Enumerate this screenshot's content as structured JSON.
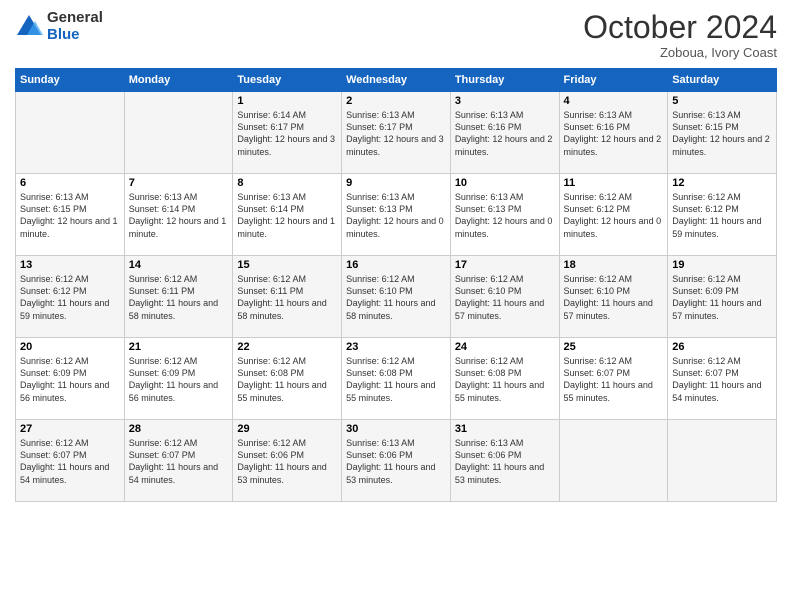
{
  "logo": {
    "general": "General",
    "blue": "Blue"
  },
  "header": {
    "month": "October 2024",
    "location": "Zoboua, Ivory Coast"
  },
  "weekdays": [
    "Sunday",
    "Monday",
    "Tuesday",
    "Wednesday",
    "Thursday",
    "Friday",
    "Saturday"
  ],
  "weeks": [
    [
      {
        "day": "",
        "text": ""
      },
      {
        "day": "",
        "text": ""
      },
      {
        "day": "1",
        "text": "Sunrise: 6:14 AM\nSunset: 6:17 PM\nDaylight: 12 hours and 3 minutes."
      },
      {
        "day": "2",
        "text": "Sunrise: 6:13 AM\nSunset: 6:17 PM\nDaylight: 12 hours and 3 minutes."
      },
      {
        "day": "3",
        "text": "Sunrise: 6:13 AM\nSunset: 6:16 PM\nDaylight: 12 hours and 2 minutes."
      },
      {
        "day": "4",
        "text": "Sunrise: 6:13 AM\nSunset: 6:16 PM\nDaylight: 12 hours and 2 minutes."
      },
      {
        "day": "5",
        "text": "Sunrise: 6:13 AM\nSunset: 6:15 PM\nDaylight: 12 hours and 2 minutes."
      }
    ],
    [
      {
        "day": "6",
        "text": "Sunrise: 6:13 AM\nSunset: 6:15 PM\nDaylight: 12 hours and 1 minute."
      },
      {
        "day": "7",
        "text": "Sunrise: 6:13 AM\nSunset: 6:14 PM\nDaylight: 12 hours and 1 minute."
      },
      {
        "day": "8",
        "text": "Sunrise: 6:13 AM\nSunset: 6:14 PM\nDaylight: 12 hours and 1 minute."
      },
      {
        "day": "9",
        "text": "Sunrise: 6:13 AM\nSunset: 6:13 PM\nDaylight: 12 hours and 0 minutes."
      },
      {
        "day": "10",
        "text": "Sunrise: 6:13 AM\nSunset: 6:13 PM\nDaylight: 12 hours and 0 minutes."
      },
      {
        "day": "11",
        "text": "Sunrise: 6:12 AM\nSunset: 6:12 PM\nDaylight: 12 hours and 0 minutes."
      },
      {
        "day": "12",
        "text": "Sunrise: 6:12 AM\nSunset: 6:12 PM\nDaylight: 11 hours and 59 minutes."
      }
    ],
    [
      {
        "day": "13",
        "text": "Sunrise: 6:12 AM\nSunset: 6:12 PM\nDaylight: 11 hours and 59 minutes."
      },
      {
        "day": "14",
        "text": "Sunrise: 6:12 AM\nSunset: 6:11 PM\nDaylight: 11 hours and 58 minutes."
      },
      {
        "day": "15",
        "text": "Sunrise: 6:12 AM\nSunset: 6:11 PM\nDaylight: 11 hours and 58 minutes."
      },
      {
        "day": "16",
        "text": "Sunrise: 6:12 AM\nSunset: 6:10 PM\nDaylight: 11 hours and 58 minutes."
      },
      {
        "day": "17",
        "text": "Sunrise: 6:12 AM\nSunset: 6:10 PM\nDaylight: 11 hours and 57 minutes."
      },
      {
        "day": "18",
        "text": "Sunrise: 6:12 AM\nSunset: 6:10 PM\nDaylight: 11 hours and 57 minutes."
      },
      {
        "day": "19",
        "text": "Sunrise: 6:12 AM\nSunset: 6:09 PM\nDaylight: 11 hours and 57 minutes."
      }
    ],
    [
      {
        "day": "20",
        "text": "Sunrise: 6:12 AM\nSunset: 6:09 PM\nDaylight: 11 hours and 56 minutes."
      },
      {
        "day": "21",
        "text": "Sunrise: 6:12 AM\nSunset: 6:09 PM\nDaylight: 11 hours and 56 minutes."
      },
      {
        "day": "22",
        "text": "Sunrise: 6:12 AM\nSunset: 6:08 PM\nDaylight: 11 hours and 55 minutes."
      },
      {
        "day": "23",
        "text": "Sunrise: 6:12 AM\nSunset: 6:08 PM\nDaylight: 11 hours and 55 minutes."
      },
      {
        "day": "24",
        "text": "Sunrise: 6:12 AM\nSunset: 6:08 PM\nDaylight: 11 hours and 55 minutes."
      },
      {
        "day": "25",
        "text": "Sunrise: 6:12 AM\nSunset: 6:07 PM\nDaylight: 11 hours and 55 minutes."
      },
      {
        "day": "26",
        "text": "Sunrise: 6:12 AM\nSunset: 6:07 PM\nDaylight: 11 hours and 54 minutes."
      }
    ],
    [
      {
        "day": "27",
        "text": "Sunrise: 6:12 AM\nSunset: 6:07 PM\nDaylight: 11 hours and 54 minutes."
      },
      {
        "day": "28",
        "text": "Sunrise: 6:12 AM\nSunset: 6:07 PM\nDaylight: 11 hours and 54 minutes."
      },
      {
        "day": "29",
        "text": "Sunrise: 6:12 AM\nSunset: 6:06 PM\nDaylight: 11 hours and 53 minutes."
      },
      {
        "day": "30",
        "text": "Sunrise: 6:13 AM\nSunset: 6:06 PM\nDaylight: 11 hours and 53 minutes."
      },
      {
        "day": "31",
        "text": "Sunrise: 6:13 AM\nSunset: 6:06 PM\nDaylight: 11 hours and 53 minutes."
      },
      {
        "day": "",
        "text": ""
      },
      {
        "day": "",
        "text": ""
      }
    ]
  ]
}
